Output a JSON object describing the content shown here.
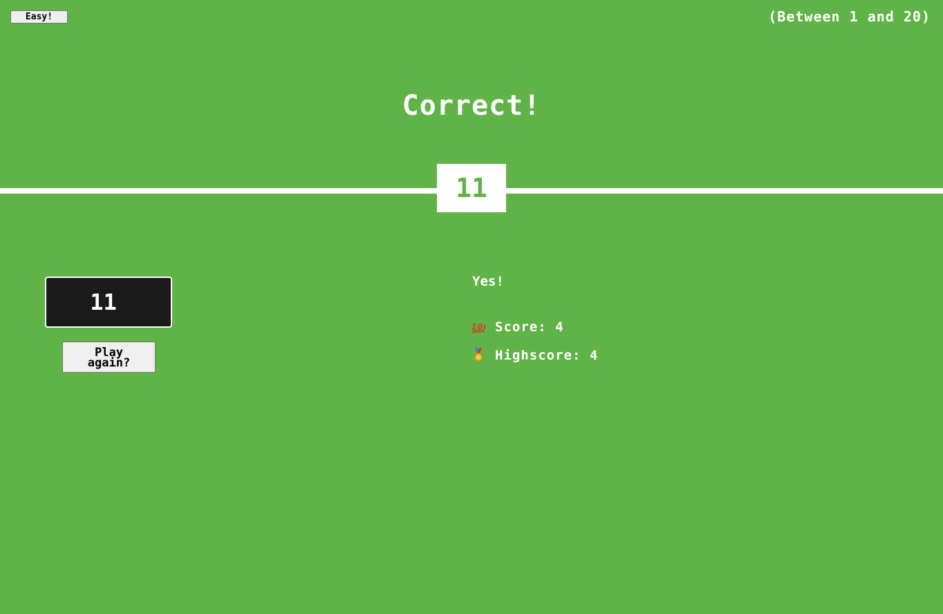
{
  "difficulty": {
    "label": "Easy!"
  },
  "range_text": "(Between 1 and 20)",
  "message_title": "Correct!",
  "secret_number": "11",
  "guess": {
    "value": "11"
  },
  "again_button": "Play again?",
  "status_message": "Yes!",
  "score": {
    "icon": "hundred-points-icon",
    "label": "Score:",
    "value": "4"
  },
  "highscore": {
    "icon": "medal-icon",
    "label": "Highscore:",
    "value": "4"
  },
  "colors": {
    "background": "#60b347",
    "text": "#ffffff",
    "input_background": "#1a1a1a"
  }
}
